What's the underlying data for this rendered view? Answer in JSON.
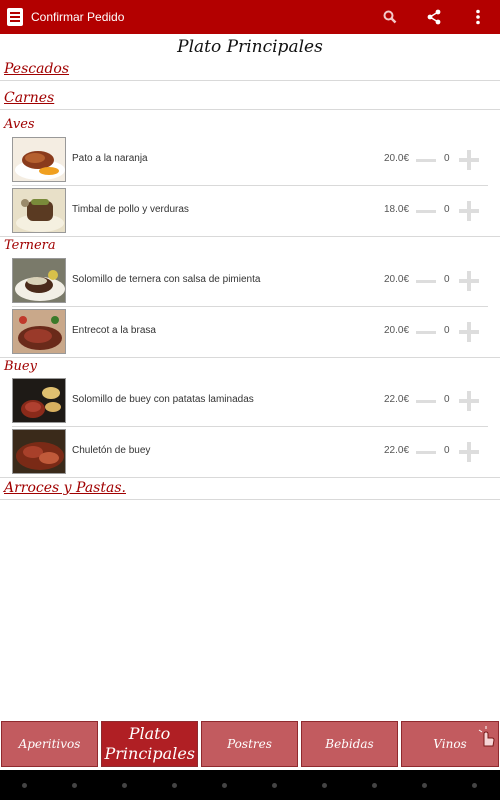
{
  "app_bar": {
    "title": "Confirmar Pedido",
    "icons": [
      "order-list-icon",
      "search-icon",
      "share-icon",
      "overflow-menu-icon"
    ],
    "color": "#b30000"
  },
  "page_title": "Plato Principales",
  "sections": {
    "pescados": "Pescados",
    "carnes": "Carnes",
    "arroces": "Arroces y Pastas."
  },
  "subsections": {
    "aves": "Aves",
    "ternera": "Ternera",
    "buey": "Buey"
  },
  "items": [
    {
      "name": "Pato a la naranja",
      "price": "20.0€",
      "qty": "0"
    },
    {
      "name": "Timbal de pollo y verduras",
      "price": "18.0€",
      "qty": "0"
    },
    {
      "name": "Solomillo de ternera con salsa de pimienta",
      "price": "20.0€",
      "qty": "0"
    },
    {
      "name": "Entrecot a la brasa",
      "price": "20.0€",
      "qty": "0"
    },
    {
      "name": "Solomillo de buey con patatas laminadas",
      "price": "22.0€",
      "qty": "0"
    },
    {
      "name": "Chuletón de buey",
      "price": "22.0€",
      "qty": "0"
    }
  ],
  "tabs": [
    {
      "label": "Aperitivos"
    },
    {
      "label": "Plato Principales"
    },
    {
      "label": "Postres"
    },
    {
      "label": "Bebidas"
    },
    {
      "label": "Vinos"
    }
  ],
  "colors": {
    "accent": "#b30000",
    "section_text": "#a00000",
    "tab_bg": "#c25b5f",
    "tab_active_bg": "#b01f24"
  }
}
